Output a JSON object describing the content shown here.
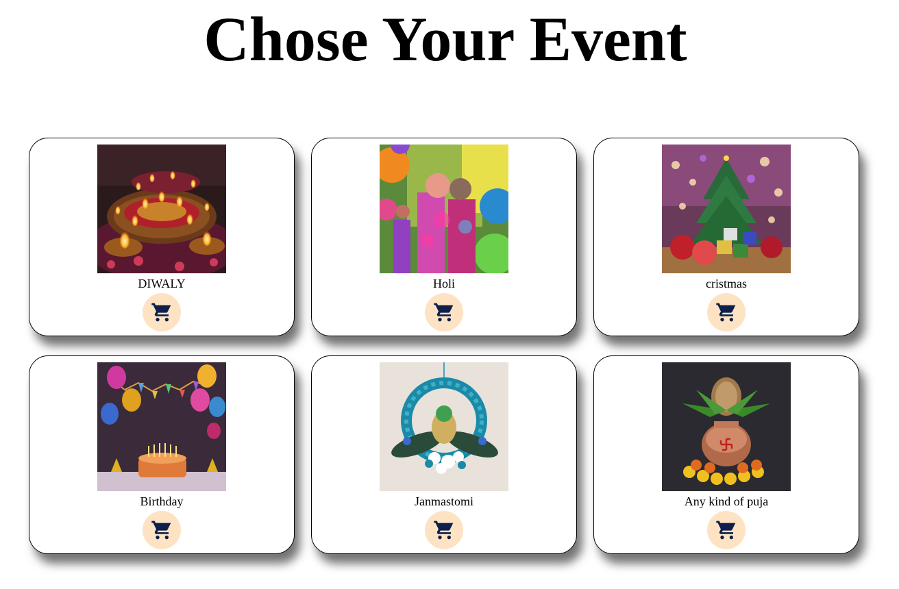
{
  "page": {
    "title": "Chose Your Event"
  },
  "colors": {
    "cart_button_bg": "#fde3c4",
    "cart_icon": "#0d1f4a"
  },
  "events": [
    {
      "label": "DIWALY",
      "image": "diwali-diyas-photo",
      "icon": "shopping-cart-icon"
    },
    {
      "label": "Holi",
      "image": "holi-colors-photo",
      "icon": "shopping-cart-icon"
    },
    {
      "label": "cristmas",
      "image": "christmas-tree-photo",
      "icon": "shopping-cart-icon"
    },
    {
      "label": "Birthday",
      "image": "birthday-cake-photo",
      "icon": "shopping-cart-icon"
    },
    {
      "label": "Janmastomi",
      "image": "janmashtami-wreath-photo",
      "icon": "shopping-cart-icon"
    },
    {
      "label": "Any kind of puja",
      "image": "puja-kalash-photo",
      "icon": "shopping-cart-icon"
    }
  ]
}
